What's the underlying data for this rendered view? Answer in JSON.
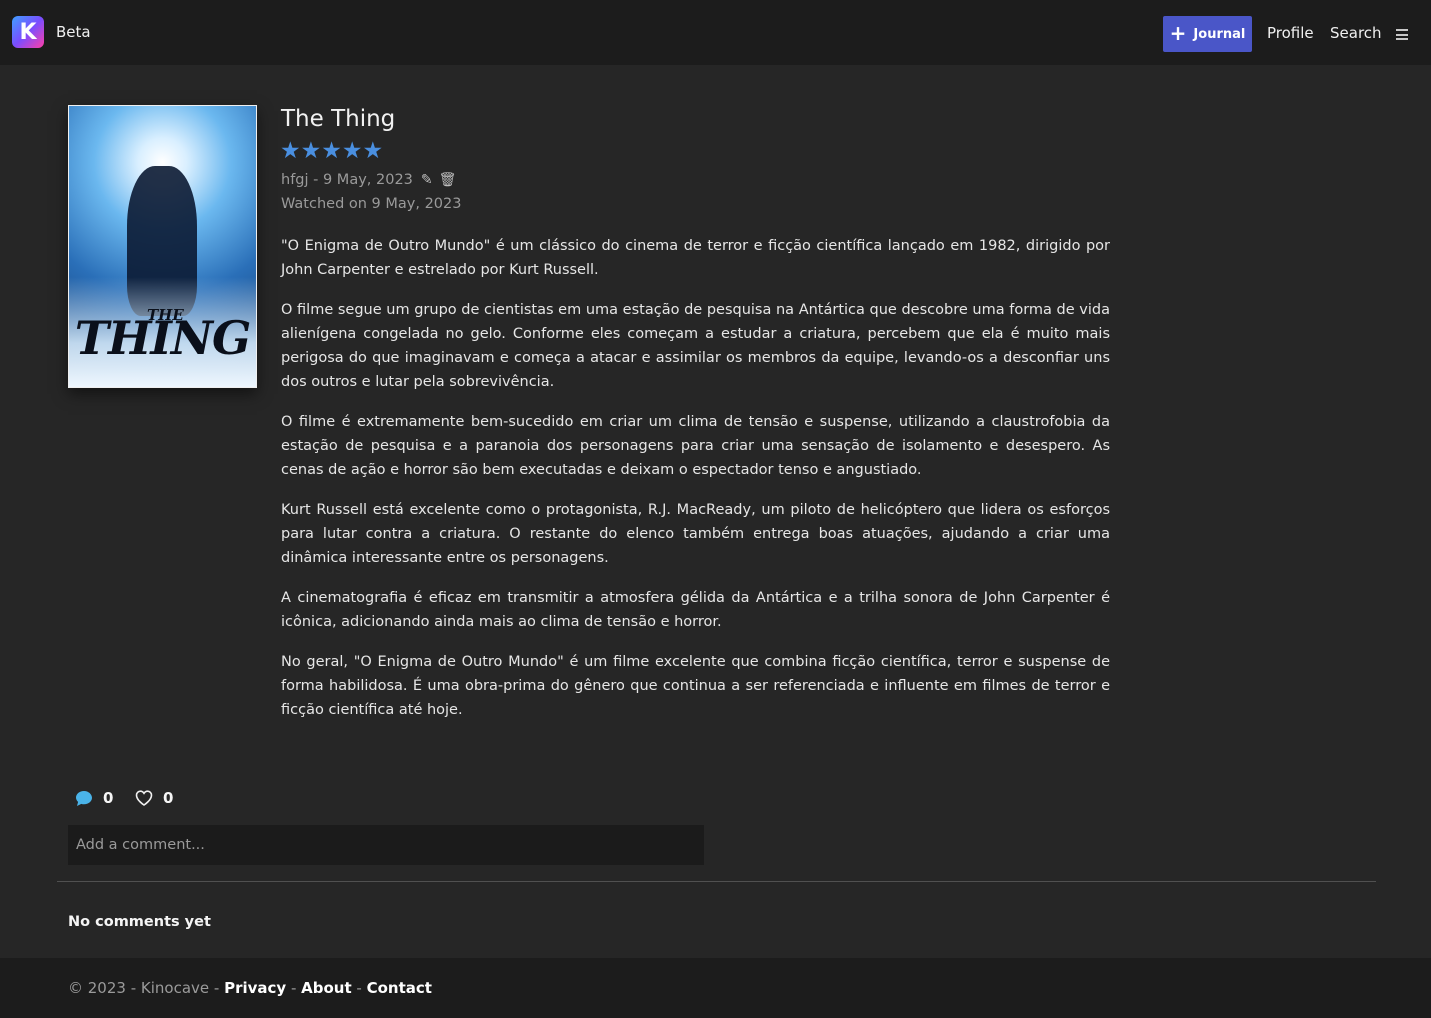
{
  "header": {
    "logo_letter": "K",
    "beta_label": "Beta",
    "journal_label": "Journal",
    "profile_label": "Profile",
    "search_label": "Search"
  },
  "entry": {
    "title": "The Thing",
    "poster_the": "THE",
    "poster_title": "THING",
    "rating_stars": 5,
    "stars_text": "★★★★★",
    "author": "hfgj",
    "date": "9 May, 2023",
    "meta_text": "hfgj - 9 May, 2023",
    "watched_text": "Watched on 9 May, 2023",
    "paragraphs": [
      "\"O Enigma de Outro Mundo\" é um clássico do cinema de terror e ficção científica lançado em 1982, dirigido por John Carpenter e estrelado por Kurt Russell.",
      "O filme segue um grupo de cientistas em uma estação de pesquisa na Antártica que descobre uma forma de vida alienígena congelada no gelo. Conforme eles começam a estudar a criatura, percebem que ela é muito mais perigosa do que imaginavam e começa a atacar e assimilar os membros da equipe, levando-os a desconfiar uns dos outros e lutar pela sobrevivência.",
      "O filme é extremamente bem-sucedido em criar um clima de tensão e suspense, utilizando a claustrofobia da estação de pesquisa e a paranoia dos personagens para criar uma sensação de isolamento e desespero. As cenas de ação e horror são bem executadas e deixam o espectador tenso e angustiado.",
      "Kurt Russell está excelente como o protagonista, R.J. MacReady, um piloto de helicóptero que lidera os esforços para lutar contra a criatura. O restante do elenco também entrega boas atuações, ajudando a criar uma dinâmica interessante entre os personagens.",
      "A cinematografia é eficaz em transmitir a atmosfera gélida da Antártica e a trilha sonora de John Carpenter é icônica, adicionando ainda mais ao clima de tensão e horror.",
      "No geral, \"O Enigma de Outro Mundo\" é um filme excelente que combina ficção científica, terror e suspense de forma habilidosa. É uma obra-prima do gênero que continua a ser referenciada e influente em filmes de terror e ficção científica até hoje."
    ]
  },
  "stats": {
    "comments_count": "0",
    "likes_count": "0"
  },
  "comments": {
    "placeholder": "Add a comment...",
    "empty_text": "No comments yet"
  },
  "footer": {
    "copyright": "© 2023 - Kinocave - ",
    "privacy": "Privacy",
    "about": "About",
    "contact": "Contact",
    "sep": " - "
  },
  "colors": {
    "accent": "#4a56c8",
    "stars": "#4a8fe0",
    "comment_icon": "#4ab3e8",
    "background": "#262626",
    "navbar": "#1c1c1c"
  },
  "icons": [
    "logo-icon",
    "plus-icon",
    "menu-icon",
    "star-icon",
    "pencil-icon",
    "trash-icon",
    "comment-icon",
    "heart-icon"
  ]
}
